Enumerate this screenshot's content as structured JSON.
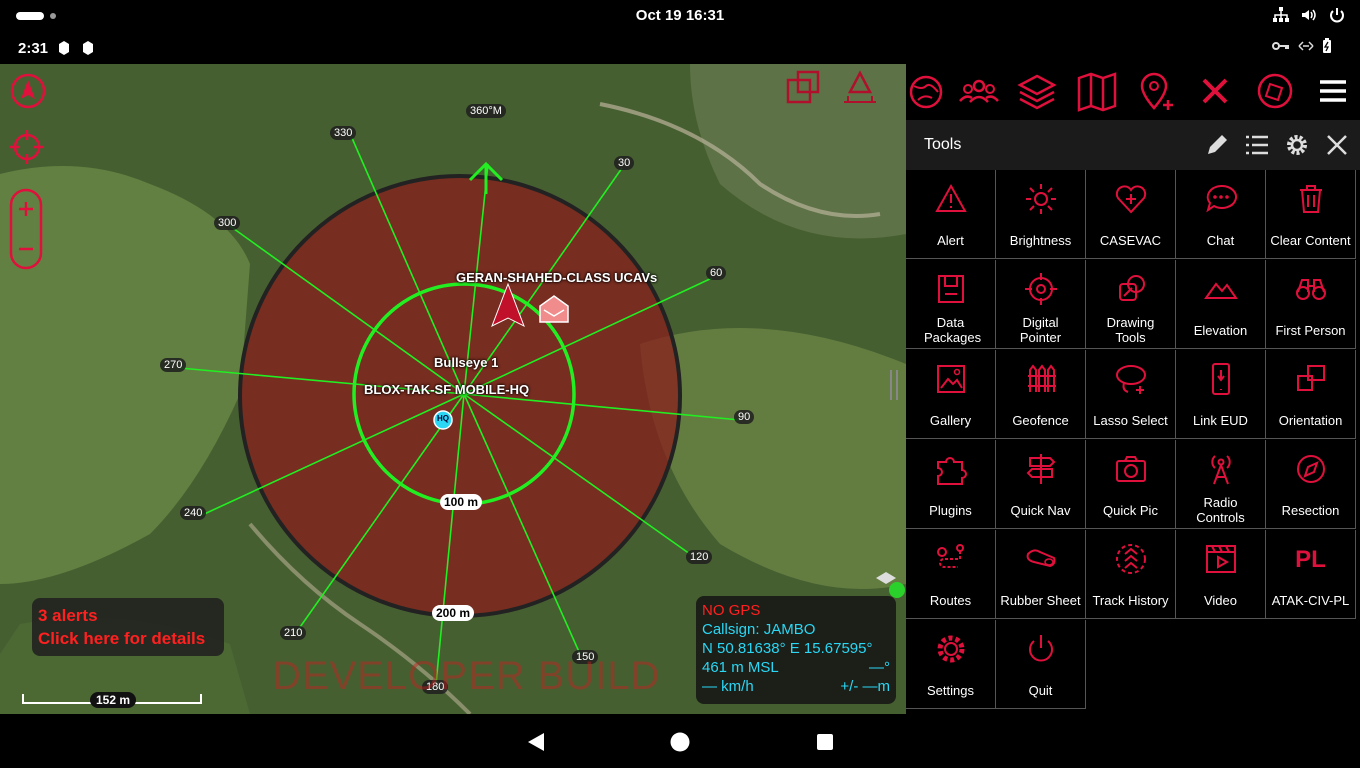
{
  "status": {
    "date_time": "Oct 19  16:31",
    "app_time": "2:31"
  },
  "map": {
    "markers": {
      "uav_label": "GERAN-SHAHED-CLASS UCAVs",
      "bullseye_label": "Bullseye 1",
      "hq_label": "BLOX-TAK-SF MOBILE-HQ",
      "hq_badge": "HQ"
    },
    "rings": {
      "inner": "100 m",
      "outer": "200 m"
    },
    "bearings": {
      "b360": "360°M",
      "b30": "30",
      "b60": "60",
      "b90": "90",
      "b120": "120",
      "b150": "150",
      "b180": "180",
      "b210": "210",
      "b240": "240",
      "b270": "270",
      "b300": "300",
      "b330": "330"
    },
    "scale": "152 m",
    "watermark": "DEVELOPER BUILD",
    "alerts": {
      "line1": "3 alerts",
      "line2": "Click here for details"
    },
    "gps": {
      "status": "NO GPS",
      "callsign": "Callsign: JAMBO",
      "coords": "N 50.81638°  E 15.67595°",
      "altitude": "461 m MSL",
      "heading": "—°",
      "speed": "— km/h",
      "accuracy": "+/- —m"
    }
  },
  "tools": {
    "title": "Tools",
    "items": [
      {
        "label": "Alert",
        "icon": "alert-icon"
      },
      {
        "label": "Brightness",
        "icon": "brightness-icon"
      },
      {
        "label": "CASEVAC",
        "icon": "casevac-icon"
      },
      {
        "label": "Chat",
        "icon": "chat-icon"
      },
      {
        "label": "Clear Content",
        "icon": "trash-icon"
      },
      {
        "label": "Data Packages",
        "icon": "data-packages-icon"
      },
      {
        "label": "Digital Pointer",
        "icon": "crosshair-icon"
      },
      {
        "label": "Drawing Tools",
        "icon": "drawing-tools-icon"
      },
      {
        "label": "Elevation",
        "icon": "mountain-icon"
      },
      {
        "label": "First Person",
        "icon": "binoculars-icon"
      },
      {
        "label": "Gallery",
        "icon": "gallery-icon"
      },
      {
        "label": "Geofence",
        "icon": "geofence-icon"
      },
      {
        "label": "Lasso Select",
        "icon": "lasso-icon"
      },
      {
        "label": "Link EUD",
        "icon": "phone-link-icon"
      },
      {
        "label": "Orientation",
        "icon": "orientation-icon"
      },
      {
        "label": "Plugins",
        "icon": "puzzle-icon"
      },
      {
        "label": "Quick Nav",
        "icon": "signpost-icon"
      },
      {
        "label": "Quick Pic",
        "icon": "camera-icon"
      },
      {
        "label": "Radio Controls",
        "icon": "radio-tower-icon"
      },
      {
        "label": "Resection",
        "icon": "resection-icon"
      },
      {
        "label": "Routes",
        "icon": "routes-icon"
      },
      {
        "label": "Rubber Sheet",
        "icon": "rubber-sheet-icon"
      },
      {
        "label": "Track History",
        "icon": "track-history-icon"
      },
      {
        "label": "Video",
        "icon": "video-icon"
      },
      {
        "label": "ATAK-CIV-PL",
        "icon": "pl-text-icon",
        "glyph": "PL"
      },
      {
        "label": "Settings",
        "icon": "gear-icon"
      },
      {
        "label": "Quit",
        "icon": "power-icon"
      }
    ]
  },
  "colors": {
    "accent": "#e0103c",
    "ring_green": "#22ee22",
    "range_fill": "#8a1a1a"
  }
}
